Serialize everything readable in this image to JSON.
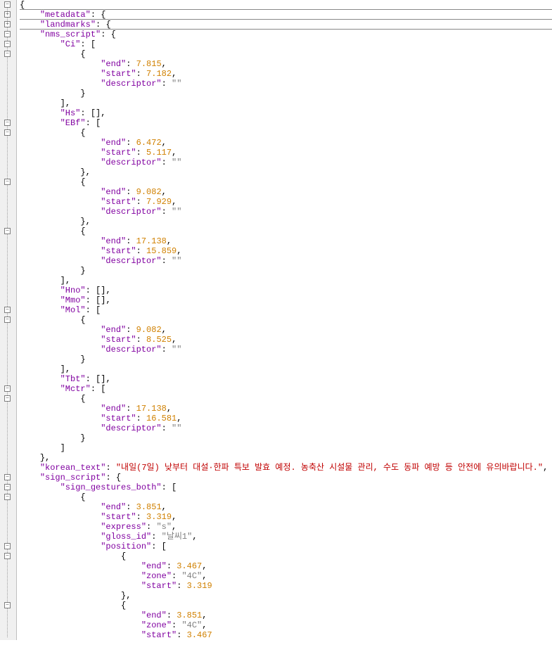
{
  "lines": [
    {
      "indent": 0,
      "type": "brace-open",
      "hr": true
    },
    {
      "indent": 1,
      "type": "key-brace",
      "key": "metadata",
      "hr": true
    },
    {
      "indent": 1,
      "type": "key-brace",
      "key": "landmarks",
      "hr": true
    },
    {
      "indent": 1,
      "type": "key-brace",
      "key": "nms_script"
    },
    {
      "indent": 2,
      "type": "key-bracket",
      "key": "Ci"
    },
    {
      "indent": 3,
      "type": "brace-open"
    },
    {
      "indent": 4,
      "type": "kv-num",
      "key": "end",
      "val": "7.815",
      "comma": true
    },
    {
      "indent": 4,
      "type": "kv-num",
      "key": "start",
      "val": "7.182",
      "comma": true
    },
    {
      "indent": 4,
      "type": "kv-str",
      "key": "descriptor",
      "val": ""
    },
    {
      "indent": 3,
      "type": "brace-close"
    },
    {
      "indent": 2,
      "type": "bracket-close",
      "comma": true
    },
    {
      "indent": 2,
      "type": "key-empty-arr",
      "key": "Hs",
      "comma": true
    },
    {
      "indent": 2,
      "type": "key-bracket",
      "key": "EBf"
    },
    {
      "indent": 3,
      "type": "brace-open"
    },
    {
      "indent": 4,
      "type": "kv-num",
      "key": "end",
      "val": "6.472",
      "comma": true
    },
    {
      "indent": 4,
      "type": "kv-num",
      "key": "start",
      "val": "5.117",
      "comma": true
    },
    {
      "indent": 4,
      "type": "kv-str",
      "key": "descriptor",
      "val": ""
    },
    {
      "indent": 3,
      "type": "brace-close-comma"
    },
    {
      "indent": 3,
      "type": "brace-open"
    },
    {
      "indent": 4,
      "type": "kv-num",
      "key": "end",
      "val": "9.082",
      "comma": true
    },
    {
      "indent": 4,
      "type": "kv-num",
      "key": "start",
      "val": "7.929",
      "comma": true
    },
    {
      "indent": 4,
      "type": "kv-str",
      "key": "descriptor",
      "val": ""
    },
    {
      "indent": 3,
      "type": "brace-close-comma"
    },
    {
      "indent": 3,
      "type": "brace-open"
    },
    {
      "indent": 4,
      "type": "kv-num",
      "key": "end",
      "val": "17.138",
      "comma": true
    },
    {
      "indent": 4,
      "type": "kv-num",
      "key": "start",
      "val": "15.859",
      "comma": true
    },
    {
      "indent": 4,
      "type": "kv-str",
      "key": "descriptor",
      "val": ""
    },
    {
      "indent": 3,
      "type": "brace-close"
    },
    {
      "indent": 2,
      "type": "bracket-close",
      "comma": true
    },
    {
      "indent": 2,
      "type": "key-empty-arr",
      "key": "Hno",
      "comma": true
    },
    {
      "indent": 2,
      "type": "key-empty-arr",
      "key": "Mmo",
      "comma": true
    },
    {
      "indent": 2,
      "type": "key-bracket",
      "key": "Mol"
    },
    {
      "indent": 3,
      "type": "brace-open"
    },
    {
      "indent": 4,
      "type": "kv-num",
      "key": "end",
      "val": "9.082",
      "comma": true
    },
    {
      "indent": 4,
      "type": "kv-num",
      "key": "start",
      "val": "8.525",
      "comma": true
    },
    {
      "indent": 4,
      "type": "kv-str",
      "key": "descriptor",
      "val": ""
    },
    {
      "indent": 3,
      "type": "brace-close"
    },
    {
      "indent": 2,
      "type": "bracket-close",
      "comma": true
    },
    {
      "indent": 2,
      "type": "key-empty-arr",
      "key": "Tbt",
      "comma": true
    },
    {
      "indent": 2,
      "type": "key-bracket",
      "key": "Mctr"
    },
    {
      "indent": 3,
      "type": "brace-open"
    },
    {
      "indent": 4,
      "type": "kv-num",
      "key": "end",
      "val": "17.138",
      "comma": true
    },
    {
      "indent": 4,
      "type": "kv-num",
      "key": "start",
      "val": "16.581",
      "comma": true
    },
    {
      "indent": 4,
      "type": "kv-str",
      "key": "descriptor",
      "val": ""
    },
    {
      "indent": 3,
      "type": "brace-close"
    },
    {
      "indent": 2,
      "type": "bracket-close"
    },
    {
      "indent": 1,
      "type": "brace-close-comma"
    },
    {
      "indent": 1,
      "type": "kv-korean",
      "key": "korean_text",
      "val": "내일(7일) 낮부터 대설·한파 특보 발효 예정. 농축산 시설물 관리, 수도 동파 예방 등 안전에 유의바랍니다.",
      "comma": true
    },
    {
      "indent": 1,
      "type": "key-brace",
      "key": "sign_script"
    },
    {
      "indent": 2,
      "type": "key-bracket",
      "key": "sign_gestures_both"
    },
    {
      "indent": 3,
      "type": "brace-open"
    },
    {
      "indent": 4,
      "type": "kv-num",
      "key": "end",
      "val": "3.851",
      "comma": true
    },
    {
      "indent": 4,
      "type": "kv-num",
      "key": "start",
      "val": "3.319",
      "comma": true
    },
    {
      "indent": 4,
      "type": "kv-strv",
      "key": "express",
      "val": "s",
      "comma": true
    },
    {
      "indent": 4,
      "type": "kv-strv",
      "key": "gloss_id",
      "val": "날씨1",
      "comma": true
    },
    {
      "indent": 4,
      "type": "key-bracket",
      "key": "position"
    },
    {
      "indent": 5,
      "type": "brace-open"
    },
    {
      "indent": 6,
      "type": "kv-num",
      "key": "end",
      "val": "3.467",
      "comma": true
    },
    {
      "indent": 6,
      "type": "kv-strv",
      "key": "zone",
      "val": "4C",
      "comma": true
    },
    {
      "indent": 6,
      "type": "kv-num",
      "key": "start",
      "val": "3.319"
    },
    {
      "indent": 5,
      "type": "brace-close-comma"
    },
    {
      "indent": 5,
      "type": "brace-open"
    },
    {
      "indent": 6,
      "type": "kv-num",
      "key": "end",
      "val": "3.851",
      "comma": true
    },
    {
      "indent": 6,
      "type": "kv-strv",
      "key": "zone",
      "val": "4C",
      "comma": true
    },
    {
      "indent": 6,
      "type": "kv-num",
      "key": "start",
      "val": "3.467"
    }
  ],
  "foldPlus": [
    1,
    2
  ],
  "foldMinus": [
    0,
    3,
    4,
    5,
    12,
    13,
    18,
    23,
    31,
    32,
    39,
    40,
    48,
    49,
    50,
    55,
    56,
    61
  ]
}
